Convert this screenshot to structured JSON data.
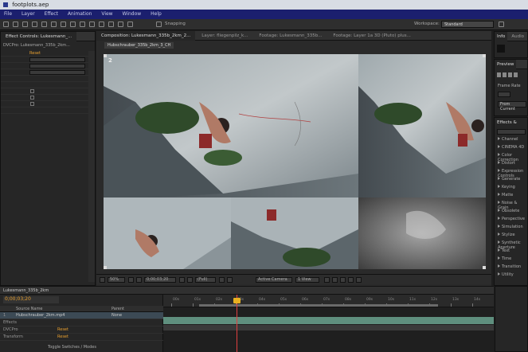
{
  "window": {
    "title": "footplots.aep"
  },
  "menu": [
    "File",
    "Layer",
    "Effect",
    "Animation",
    "View",
    "Window",
    "Help"
  ],
  "toolbar": {
    "snapping_label": "Snapping",
    "workspace_label": "Workspace:",
    "workspace_value": "Standard"
  },
  "left_panel": {
    "tabs": [
      "Effect Controls: Lukesmann_..."
    ],
    "subtitle": "DVCPro: Lukesmann_335b_2km...",
    "rows": [
      {
        "label": "",
        "value": "Reset",
        "kind": "text"
      },
      {
        "label": "",
        "value": "",
        "kind": "dropdown"
      },
      {
        "label": "",
        "value": "",
        "kind": "dropdown"
      },
      {
        "label": "",
        "value": "",
        "kind": "dropdown"
      },
      {
        "label": "",
        "value": "",
        "kind": "text"
      },
      {
        "label": "",
        "value": "",
        "kind": "text"
      },
      {
        "label": "",
        "value": "",
        "kind": "checkbox"
      },
      {
        "label": "",
        "value": "",
        "kind": "checkbox"
      },
      {
        "label": "",
        "value": "",
        "kind": "checkbox"
      },
      {
        "label": "",
        "value": "",
        "kind": "text"
      }
    ]
  },
  "viewer": {
    "tabs": [
      "Composition: Lukesmann_335b_2km_2...",
      "Layer: fliegenpilz_k...",
      "Footage: Lukesmann_335b...",
      "Footage: Layer 1a 3D (Pluto) plus..."
    ],
    "comp_name": "Hubschrauber_335b_2km_3_CH",
    "layer_tag": "2",
    "zoom": "50%",
    "timecode": "0;00;03;20",
    "resolution": "(Full)",
    "camera": "Active Camera",
    "views": "1 View"
  },
  "right_panel": {
    "tabs": [
      "Info",
      "Audio"
    ],
    "preview_label": "Preview",
    "frame_rate_label": "Frame Rate",
    "from_current_label": "From Current",
    "effects_label": "Effects & Presets",
    "categories": [
      "Channel",
      "CINEMA 4D",
      "Color Correction",
      "Distort",
      "Expression Controls",
      "Generate",
      "Keying",
      "Matte",
      "Noise & Grain",
      "Obsolete",
      "Perspective",
      "Simulation",
      "Stylize",
      "Synthetic Aperture",
      "Text",
      "Time",
      "Transition",
      "Utility"
    ]
  },
  "timeline": {
    "tab": "Lukesmann_335b_2km",
    "timecode": "0;00;03;20",
    "col_source": "Source Name",
    "col_parent": "Parent",
    "layers": [
      {
        "num": "1",
        "name": "Hubschrauber_2km.mp4",
        "parent": "None"
      },
      {
        "num": "",
        "name": "Effects",
        "parent": ""
      },
      {
        "num": "",
        "name": "DVCPro",
        "parent": "Reset"
      },
      {
        "num": "",
        "name": "Transform",
        "parent": "Reset"
      }
    ],
    "toggle_label": "Toggle Switches / Modes",
    "ticks": [
      "00s",
      "01s",
      "02s",
      "03s",
      "04s",
      "05s",
      "06s",
      "07s",
      "08s",
      "09s",
      "10s",
      "11s",
      "12s",
      "13s",
      "14s"
    ]
  },
  "colors": {
    "accent": "#e8a030",
    "menubar": "#1b1f6e",
    "playhead": "#e04040",
    "track": "#5f8f7e"
  }
}
